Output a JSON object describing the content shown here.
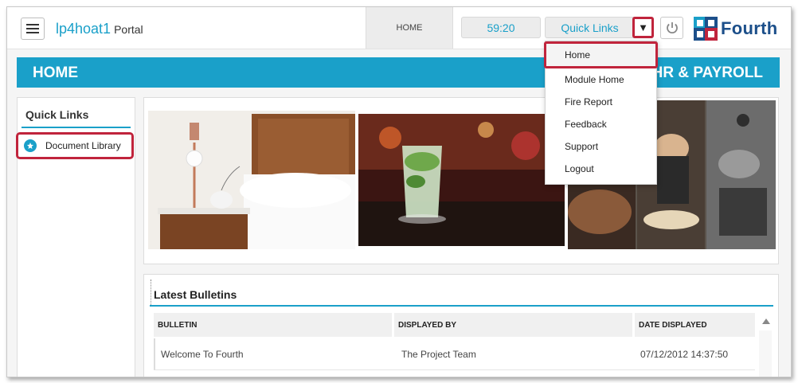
{
  "header": {
    "app_name": "lp4hoat1",
    "app_suffix": "Portal",
    "home_tab": "HOME",
    "timer": "59:20",
    "quick_links_label": "Quick Links",
    "logo_text": "Fourth"
  },
  "banner": {
    "title": "HOME",
    "right_title": "HR & PAYROLL"
  },
  "sidebar": {
    "title": "Quick Links",
    "items": [
      {
        "label": "Document Library",
        "icon": "pin-icon"
      }
    ]
  },
  "dropdown": {
    "items": [
      {
        "label": "Home",
        "highlighted": true
      },
      {
        "label": "Module Home"
      },
      {
        "label": "Fire Report"
      },
      {
        "label": "Feedback"
      },
      {
        "label": "Support"
      },
      {
        "label": "Logout"
      }
    ]
  },
  "bulletins": {
    "title": "Latest Bulletins",
    "columns": [
      "BULLETIN",
      "DISPLAYED BY",
      "DATE DISPLAYED"
    ],
    "rows": [
      [
        "Welcome To Fourth",
        "The Project Team",
        "07/12/2012 14:37:50"
      ]
    ]
  },
  "colors": {
    "accent": "#1aa0c9",
    "highlight": "#c0243c",
    "logo": "#1c4f8a"
  }
}
